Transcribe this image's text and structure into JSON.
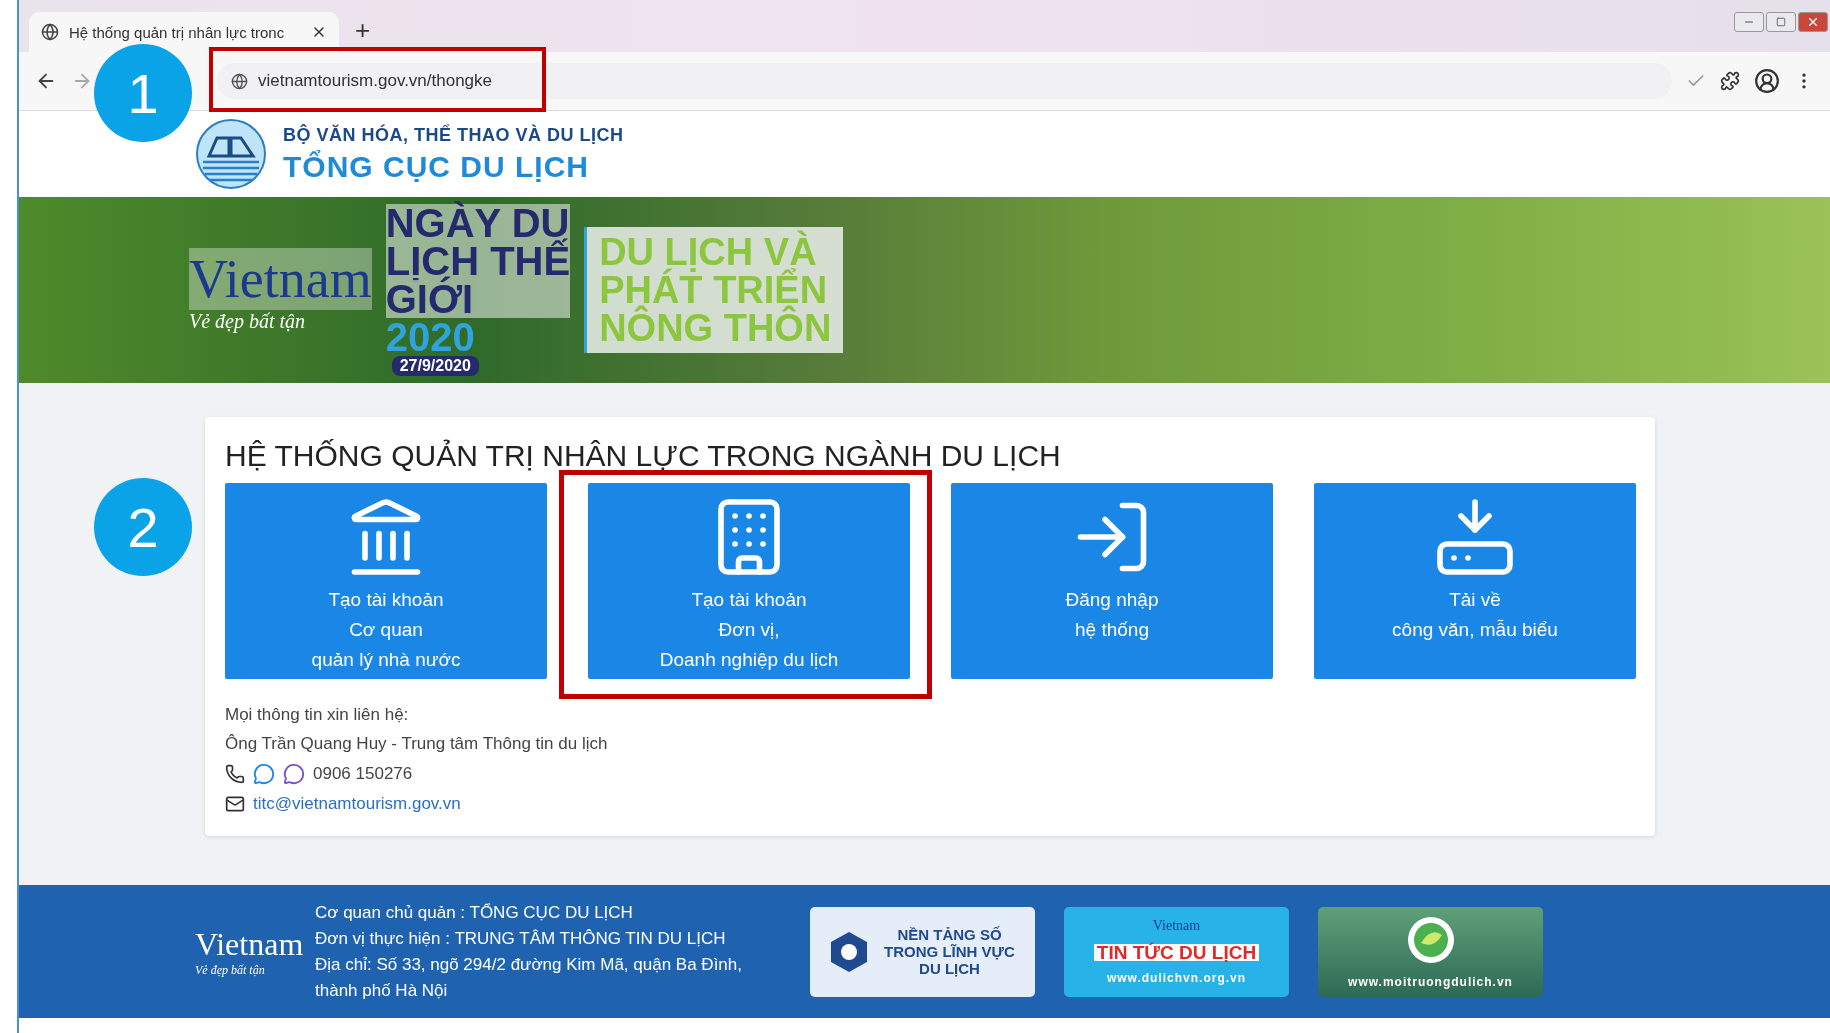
{
  "browser": {
    "tab": {
      "title": "Hệ thống quản trị nhân lực tronc",
      "selected": true
    },
    "new_tab": "+",
    "url": "vietnamtourism.gov.vn/thongke",
    "url_highlighted": true
  },
  "callouts": [
    {
      "label": "1"
    },
    {
      "label": "2"
    }
  ],
  "header": {
    "ministry": "BỘ VĂN HÓA, THỂ THAO VÀ DU LỊCH",
    "agency": "TỔNG CỤC DU LỊCH"
  },
  "banner": {
    "logo_word": "Vietnam",
    "logo_tagline": "Vẻ đẹp bất tận",
    "headline": [
      "NGÀY DU",
      "LỊCH THẾ",
      "GIỚI"
    ],
    "year": "2020",
    "date": "27/9/2020",
    "slogan": [
      "DU LỊCH VÀ",
      "PHÁT TRIỂN",
      "NÔNG THÔN"
    ]
  },
  "main": {
    "title": "HỆ THỐNG QUẢN TRỊ NHÂN LỰC TRONG NGÀNH DU LỊCH",
    "actions": [
      {
        "kind": "agency",
        "lines": [
          "Tạo tài khoản",
          "Cơ quan",
          "quản lý nhà nước"
        ],
        "highlighted": false
      },
      {
        "kind": "business",
        "lines": [
          "Tạo tài khoản",
          "Đơn vị,",
          "Doanh nghiệp du lịch"
        ],
        "highlighted": true
      },
      {
        "kind": "login",
        "lines": [
          "Đăng nhập",
          "hệ thống"
        ],
        "highlighted": false
      },
      {
        "kind": "download",
        "lines": [
          "Tải về",
          "công văn, mẫu biểu"
        ],
        "highlighted": false
      }
    ],
    "contact": {
      "intro": "Mọi thông tin xin liên hệ:",
      "person": "Ông Trần Quang Huy - Trung tâm Thông tin du lịch",
      "phone": "0906 150276",
      "email": "titc@vietnamtourism.gov.vn"
    }
  },
  "footer": {
    "logo_word": "Vietnam",
    "logo_tagline": "Vẻ đẹp bất tận",
    "lines": [
      "Cơ quan chủ quản : TỔNG CỤC DU LỊCH",
      "Đơn vị thực hiện : TRUNG TÂM THÔNG TIN DU LỊCH",
      "Địa chỉ: Số 33, ngõ 294/2 đường Kim Mã, quận Ba Đình,",
      "thành phố Hà Nội"
    ],
    "partners": [
      {
        "kind": "platform",
        "lines": [
          "NỀN TẢNG SỐ",
          "TRONG LĨNH VỰC",
          "DU LỊCH"
        ]
      },
      {
        "kind": "news",
        "logo_word": "Vietnam",
        "lines": [
          "TIN TỨC DU LỊCH"
        ],
        "url": "www.dulichvn.org.vn"
      },
      {
        "kind": "environment",
        "url": "www.moitruongdulich.vn"
      }
    ]
  }
}
